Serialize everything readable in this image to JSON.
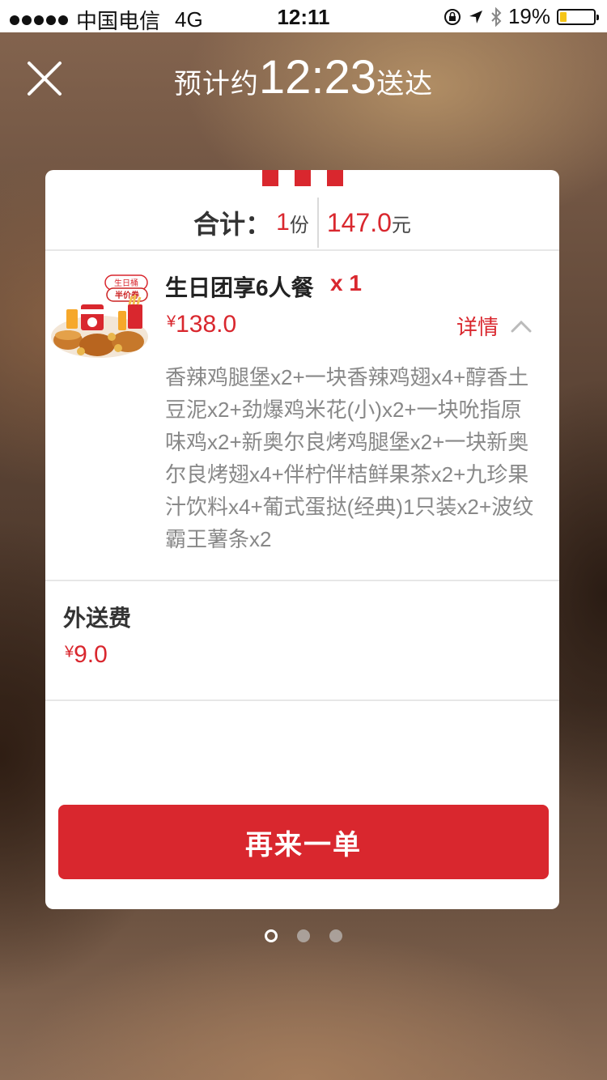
{
  "status_bar": {
    "carrier": "中国电信",
    "network": "4G",
    "time": "12:11",
    "battery_pct": "19%",
    "battery_level": 0.19
  },
  "header": {
    "title_prefix": "预计约",
    "eta_time": "12:23",
    "title_suffix": "送达"
  },
  "summary": {
    "label": "合计：",
    "count": "1",
    "count_unit": "份",
    "total": "147.0",
    "total_unit": "元"
  },
  "item": {
    "name": "生日团享6人餐",
    "qty": "x 1",
    "currency": "¥",
    "price": "138.0",
    "detail_label": "详情",
    "description": "香辣鸡腿堡x2+一块香辣鸡翅x4+醇香土豆泥x2+劲爆鸡米花(小)x2+一块吮指原味鸡x2+新奥尔良烤鸡腿堡x2+一块新奥尔良烤翅x4+伴柠伴桔鲜果茶x2+九珍果汁饮料x4+葡式蛋挞(经典)1只装x2+波纹霸王薯条x2",
    "image_badge_text": "半价券",
    "image_badge_small": "生日桶"
  },
  "delivery_fee": {
    "label": "外送费",
    "currency": "¥",
    "price": "9.0"
  },
  "actions": {
    "reorder_label": "再来一单"
  },
  "colors": {
    "accent": "#d9272e",
    "battery": "#f5c518"
  },
  "pager": {
    "pages": 3,
    "active": 0
  }
}
